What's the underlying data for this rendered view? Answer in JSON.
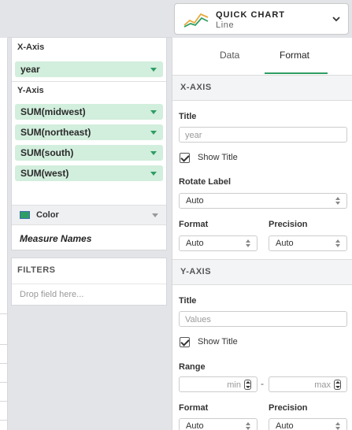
{
  "quick_chart": {
    "title": "QUICK CHART",
    "subtitle": "Line"
  },
  "encodings": {
    "x_axis_label": "X-Axis",
    "x_fields": [
      "year"
    ],
    "y_axis_label": "Y-Axis",
    "y_fields": [
      "SUM(midwest)",
      "SUM(northeast)",
      "SUM(south)",
      "SUM(west)"
    ],
    "color_label": "Color",
    "color_value": "Measure Names"
  },
  "filters": {
    "title": "FILTERS",
    "placeholder": "Drop field here..."
  },
  "tabs": {
    "data": "Data",
    "format": "Format",
    "active": "Format"
  },
  "x_axis": {
    "heading": "X-AXIS",
    "title_label": "Title",
    "title_placeholder": "year",
    "show_title_label": "Show Title",
    "show_title_checked": true,
    "rotate_label": "Rotate Label",
    "rotate_value": "Auto",
    "format_label": "Format",
    "format_value": "Auto",
    "precision_label": "Precision",
    "precision_value": "Auto"
  },
  "y_axis": {
    "heading": "Y-AXIS",
    "title_label": "Title",
    "title_placeholder": "Values",
    "show_title_label": "Show Title",
    "show_title_checked": true,
    "range_label": "Range",
    "range_min_placeholder": "min",
    "range_separator": "-",
    "range_max_placeholder": "max",
    "format_label": "Format",
    "format_value": "Auto",
    "precision_label": "Precision",
    "precision_value": "Auto"
  },
  "colors": {
    "accent": "#2e9e63",
    "pill_bg": "#d2eedd",
    "panel_bg": "#e3e4e8"
  }
}
